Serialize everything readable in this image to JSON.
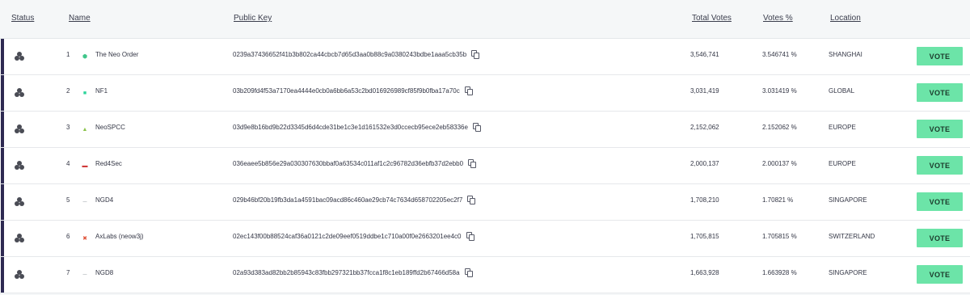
{
  "headers": {
    "status": "Status",
    "name": "Name",
    "public_key": "Public Key",
    "total_votes": "Total Votes",
    "votes_pct": "Votes %",
    "location": "Location"
  },
  "vote_label": "VOTE",
  "rows": [
    {
      "rank": "1",
      "name": "The Neo Order",
      "key": "0239a37436652f41b3b802ca44cbcb7d65d3aa0b88c9a0380243bdbe1aaa5cb35b",
      "votes": "3,546,741",
      "pct": "3.546741 %",
      "location": "SHANGHAI",
      "logo": "neo-order-logo-icon",
      "logo_color": "#3fc68a"
    },
    {
      "rank": "2",
      "name": "NF1",
      "key": "03b209fd4f53a7170ea4444e0cb0a6bb6a53c2bd016926989cf85f9b0fba17a70c",
      "votes": "3,031,419",
      "pct": "3.031419 %",
      "location": "GLOBAL",
      "logo": "nf1-logo-icon",
      "logo_color": "#2cd49a"
    },
    {
      "rank": "3",
      "name": "NeoSPCC",
      "key": "03d9e8b16bd9b22d3345d6d4cde31be1c3e1d161532e3d0ccecb95ece2eb58336e",
      "votes": "2,152,062",
      "pct": "2.152062 %",
      "location": "EUROPE",
      "logo": "neospcc-logo-icon",
      "logo_color": "#8bc34a"
    },
    {
      "rank": "4",
      "name": "Red4Sec",
      "key": "036eaee5b856e29a030307630bbaf0a63534c011af1c2c96782d36ebfb37d2ebb0",
      "votes": "2,000,137",
      "pct": "2.000137 %",
      "location": "EUROPE",
      "logo": "red4sec-logo-icon",
      "logo_color": "#d03a3a"
    },
    {
      "rank": "5",
      "name": "NGD4",
      "key": "029b46bf20b19fb3da1a4591bac09acd86c460ae29cb74c7634d658702205ec2f7",
      "votes": "1,708,210",
      "pct": "1.70821 %",
      "location": "SINGAPORE",
      "logo": "ngd-logo-icon",
      "logo_color": "#9aa0a6"
    },
    {
      "rank": "6",
      "name": "AxLabs (neow3j)",
      "key": "02ec143f00b88524caf36a0121c2de09eef0519ddbe1c710a00f0e2663201ee4c0",
      "votes": "1,705,815",
      "pct": "1.705815 %",
      "location": "SWITZERLAND",
      "logo": "axlabs-logo-icon",
      "logo_color": "#e0533a"
    },
    {
      "rank": "7",
      "name": "NGD8",
      "key": "02a93d383ad82bb2b85943c83fbb297321bb37fcca1f8c1eb189ffd2b67466d58a",
      "votes": "1,663,928",
      "pct": "1.663928 %",
      "location": "SINGAPORE",
      "logo": "ngd-logo-icon",
      "logo_color": "#9aa0a6"
    }
  ]
}
